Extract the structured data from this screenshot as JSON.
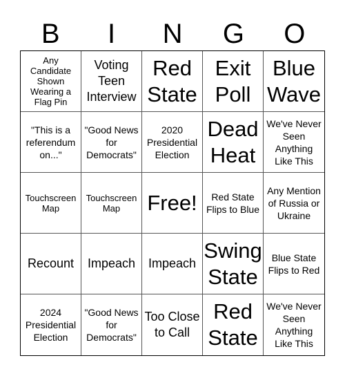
{
  "header": {
    "letters": [
      "B",
      "I",
      "N",
      "G",
      "O"
    ]
  },
  "cells": [
    {
      "text": "Any Candidate Shown Wearing a Flag Pin",
      "size": "s-sm"
    },
    {
      "text": "Voting Teen Interview",
      "size": "s-lg"
    },
    {
      "text": "Red State",
      "size": "s-xl"
    },
    {
      "text": "Exit Poll",
      "size": "s-xl"
    },
    {
      "text": "Blue Wave",
      "size": "s-xl"
    },
    {
      "text": "\"This is a referendum on...\"",
      "size": "s-md"
    },
    {
      "text": "\"Good News for Democrats\"",
      "size": "s-md"
    },
    {
      "text": "2020 Presidential Election",
      "size": "s-md"
    },
    {
      "text": "Dead Heat",
      "size": "s-xl"
    },
    {
      "text": "We've Never Seen Anything Like This",
      "size": "s-md"
    },
    {
      "text": "Touchscreen Map",
      "size": "s-sm"
    },
    {
      "text": "Touchscreen Map",
      "size": "s-sm"
    },
    {
      "text": "Free!",
      "size": "s-xl"
    },
    {
      "text": "Red State Flips to Blue",
      "size": "s-md"
    },
    {
      "text": "Any Mention of Russia or Ukraine",
      "size": "s-md"
    },
    {
      "text": "Recount",
      "size": "s-lg"
    },
    {
      "text": "Impeach",
      "size": "s-lg"
    },
    {
      "text": "Impeach",
      "size": "s-lg"
    },
    {
      "text": "Swing State",
      "size": "s-xl"
    },
    {
      "text": "Blue State Flips to Red",
      "size": "s-md"
    },
    {
      "text": "2024 Presidential Election",
      "size": "s-md"
    },
    {
      "text": "\"Good News for Democrats\"",
      "size": "s-md"
    },
    {
      "text": "Too Close to Call",
      "size": "s-lg"
    },
    {
      "text": "Red State",
      "size": "s-xl"
    },
    {
      "text": "We've Never Seen Anything Like This",
      "size": "s-md"
    }
  ]
}
